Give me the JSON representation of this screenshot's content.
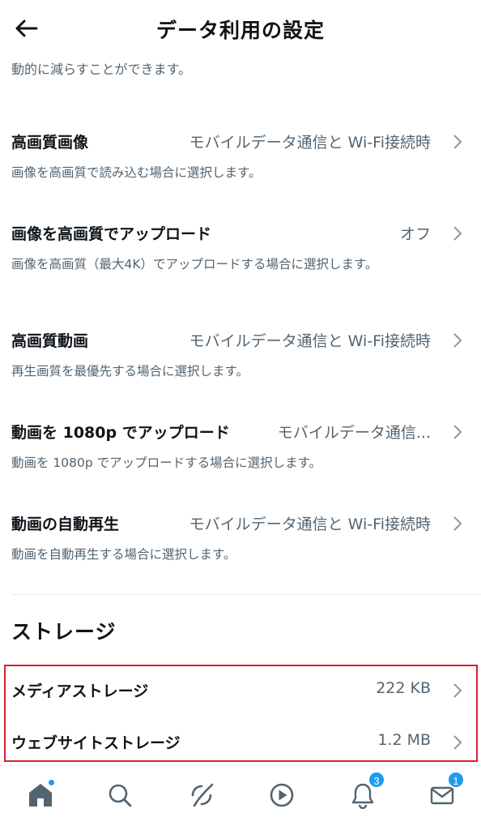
{
  "header": {
    "title": "データ利用の設定"
  },
  "intro_text": "動的に減らすことができます。",
  "settings": [
    {
      "label": "高画質画像",
      "value": "モバイルデータ通信と Wi-Fi接続時",
      "description": "画像を高画質で読み込む場合に選択します。"
    },
    {
      "label": "画像を高画質でアップロード",
      "value": "オフ",
      "description": "画像を高画質（最大4K）でアップロードする場合に選択します。"
    },
    {
      "label": "高画質動画",
      "value": "モバイルデータ通信と Wi-Fi接続時",
      "description": "再生画質を最優先する場合に選択します。"
    },
    {
      "label": "動画を 1080p でアップロード",
      "value": "モバイルデータ通信...",
      "description": "動画を 1080p でアップロードする場合に選択します。"
    },
    {
      "label": "動画の自動再生",
      "value": "モバイルデータ通信と Wi-Fi接続時",
      "description": "動画を自動再生する場合に選択します。"
    }
  ],
  "storage": {
    "title": "ストレージ",
    "items": [
      {
        "label": "メディアストレージ",
        "value": "222 KB"
      },
      {
        "label": "ウェブサイトストレージ",
        "value": "1.2 MB"
      }
    ]
  },
  "tabbar": {
    "items": [
      {
        "icon": "home-icon"
      },
      {
        "icon": "search-icon"
      },
      {
        "icon": "spaces-icon"
      },
      {
        "icon": "video-icon"
      },
      {
        "icon": "notifications-icon",
        "badge": "3"
      },
      {
        "icon": "messages-icon",
        "badge": "1"
      }
    ]
  },
  "colors": {
    "accent": "#1d9bf0",
    "highlight": "#d6202f",
    "secondary_text": "#536471"
  }
}
